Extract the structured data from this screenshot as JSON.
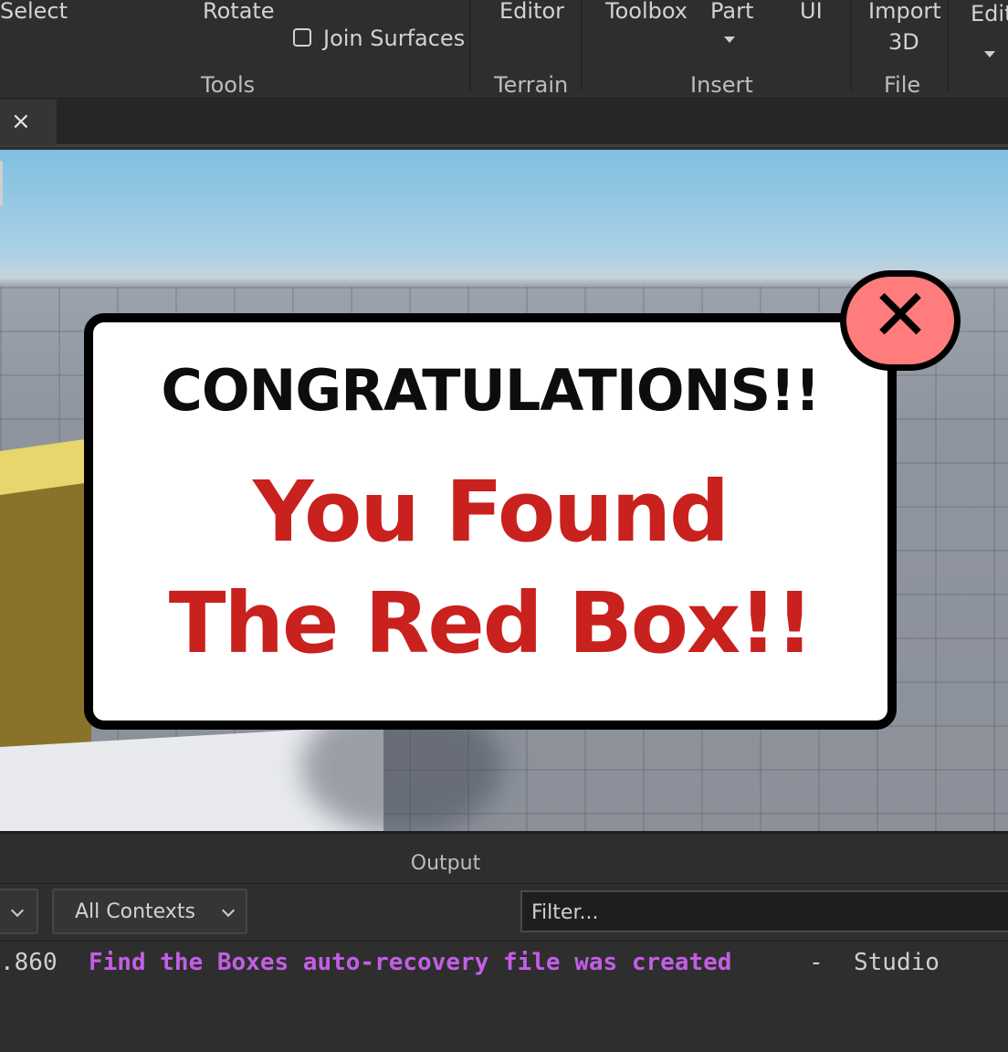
{
  "ribbon": {
    "select_label": "Select",
    "rotate_label": "Rotate",
    "join_surfaces_label": "Join Surfaces",
    "tools_group": "Tools",
    "editor_label": "Editor",
    "terrain_group": "Terrain",
    "toolbox_label": "Toolbox",
    "part_label": "Part",
    "ui_label": "UI",
    "insert_group": "Insert",
    "import_label": "Import",
    "import_label_2": "3D",
    "file_group": "File",
    "edit_label": "Edit"
  },
  "tab": {
    "close_glyph": "×"
  },
  "popup": {
    "title": "CONGRATULATIONS!!",
    "line1": "You Found",
    "line2": "The Red Box!!",
    "close_glyph": "✕"
  },
  "output": {
    "title": "Output",
    "contexts_label": "All Contexts",
    "filter_placeholder": "Filter...",
    "log": {
      "time": ".860",
      "message": "Find the Boxes auto-recovery file was created",
      "separator": "-",
      "source": "Studio"
    }
  },
  "colors": {
    "message": "#c45ee6",
    "popup_red": "#c8211e",
    "close_bg": "#ff7c7c"
  }
}
